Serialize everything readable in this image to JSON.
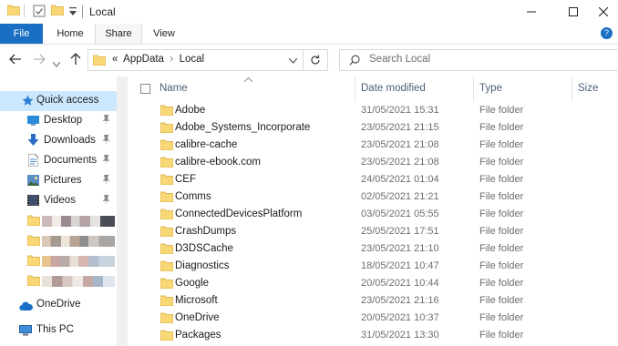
{
  "window": {
    "title": "Local",
    "controls": {
      "minimize": "minimize-icon",
      "maximize": "maximize-icon",
      "close": "close-icon"
    }
  },
  "ribbon": {
    "tabs": [
      {
        "label": "File"
      },
      {
        "label": "Home"
      },
      {
        "label": "Share"
      },
      {
        "label": "View"
      }
    ],
    "help_label": "?"
  },
  "navigation": {
    "breadcrumb_prefix": "«",
    "breadcrumb": [
      "AppData",
      "Local"
    ],
    "breadcrumb_separator": "›",
    "search_placeholder": "Search Local"
  },
  "sidebar": {
    "items": [
      {
        "label": "Quick access",
        "icon": "star-icon",
        "selected": true
      },
      {
        "label": "Desktop",
        "icon": "desktop-icon",
        "pinned": true
      },
      {
        "label": "Downloads",
        "icon": "download-icon",
        "pinned": true
      },
      {
        "label": "Documents",
        "icon": "document-icon",
        "pinned": true
      },
      {
        "label": "Pictures",
        "icon": "pictures-icon",
        "pinned": true
      },
      {
        "label": "Videos",
        "icon": "video-icon",
        "pinned": true
      },
      {
        "label": "OneDrive",
        "icon": "cloud-icon"
      },
      {
        "label": "This PC",
        "icon": "computer-icon"
      }
    ]
  },
  "file_list": {
    "columns": [
      "Name",
      "Date modified",
      "Type",
      "Size"
    ],
    "rows": [
      {
        "name": "Adobe",
        "date": "31/05/2021 15:31",
        "type": "File folder"
      },
      {
        "name": "Adobe_Systems_Incorporate",
        "date": "23/05/2021 21:15",
        "type": "File folder"
      },
      {
        "name": "calibre-cache",
        "date": "23/05/2021 21:08",
        "type": "File folder"
      },
      {
        "name": "calibre-ebook.com",
        "date": "23/05/2021 21:08",
        "type": "File folder"
      },
      {
        "name": "CEF",
        "date": "24/05/2021 01:04",
        "type": "File folder"
      },
      {
        "name": "Comms",
        "date": "02/05/2021 21:21",
        "type": "File folder"
      },
      {
        "name": "ConnectedDevicesPlatform",
        "date": "03/05/2021 05:55",
        "type": "File folder"
      },
      {
        "name": "CrashDumps",
        "date": "25/05/2021 17:51",
        "type": "File folder"
      },
      {
        "name": "D3DSCache",
        "date": "23/05/2021 21:10",
        "type": "File folder"
      },
      {
        "name": "Diagnostics",
        "date": "18/05/2021 10:47",
        "type": "File folder"
      },
      {
        "name": "Google",
        "date": "20/05/2021 10:44",
        "type": "File folder"
      },
      {
        "name": "Microsoft",
        "date": "23/05/2021 21:16",
        "type": "File folder"
      },
      {
        "name": "OneDrive",
        "date": "20/05/2021 10:37",
        "type": "File folder"
      },
      {
        "name": "Packages",
        "date": "31/05/2021 13:30",
        "type": "File folder"
      }
    ]
  },
  "colors": {
    "accent": "#1a6fc4",
    "selection": "#cce8ff",
    "folder": "#f8d775",
    "header_text": "#4c607a",
    "secondary_text": "#6d6d6d"
  }
}
